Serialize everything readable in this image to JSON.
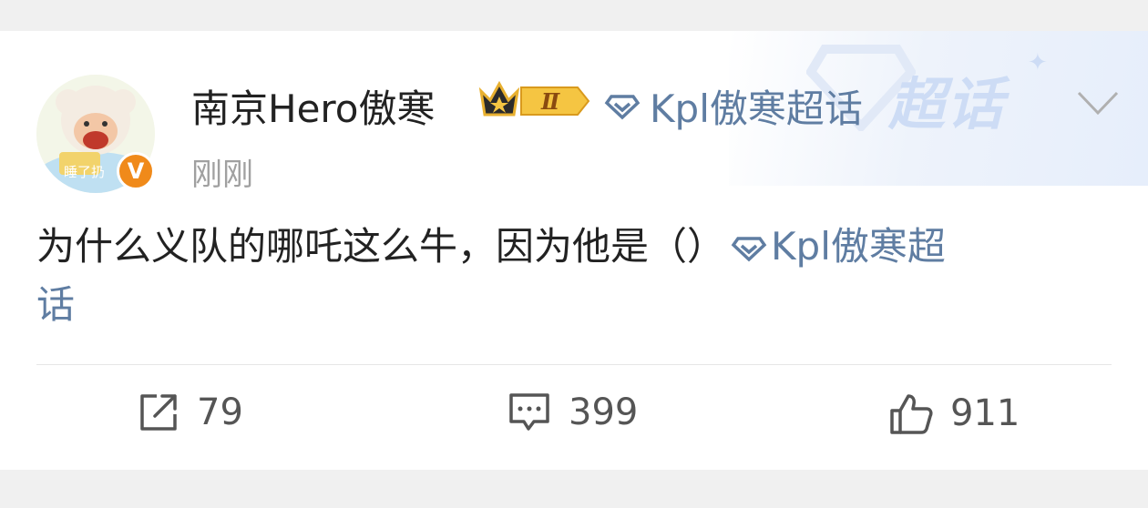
{
  "post": {
    "author": {
      "name": "南京Hero傲寒",
      "avatar_text": "睡了扔",
      "verified_badge": "V",
      "crown_level": "Ⅱ"
    },
    "super_topic": {
      "label": "Kpl傲寒超话",
      "watermark": "超话"
    },
    "timestamp": "刚刚",
    "body": {
      "text": "为什么义队的哪吒这么牛，因为他是（）",
      "topic_line1": "Kpl傲寒超",
      "topic_line2": "话"
    },
    "actions": {
      "repost_count": "79",
      "comment_count": "399",
      "like_count": "911"
    }
  },
  "colors": {
    "link": "#5f7da2",
    "badge_orange": "#f08a1a",
    "crown_gold": "#e8b030"
  }
}
